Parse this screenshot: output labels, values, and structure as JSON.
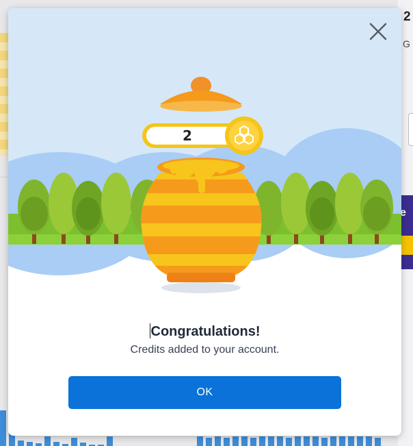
{
  "background": {
    "right_heading": "2",
    "right_sub": "G",
    "right_banner_text": "e"
  },
  "modal": {
    "credit_count": "2",
    "title": "Congratulations!",
    "message": "Credits added to your account.",
    "ok_label": "OK",
    "close_icon": "close-icon",
    "illustration": "honey-pot-illustration",
    "colors": {
      "sky": "#d6e8f8",
      "hills": "#a9cdf5",
      "grass": "#78b72e",
      "pot_orange": "#f59a1b",
      "pot_yellow": "#f7c51c",
      "ok_button": "#0a72d8",
      "coin": "#f5c518"
    }
  }
}
